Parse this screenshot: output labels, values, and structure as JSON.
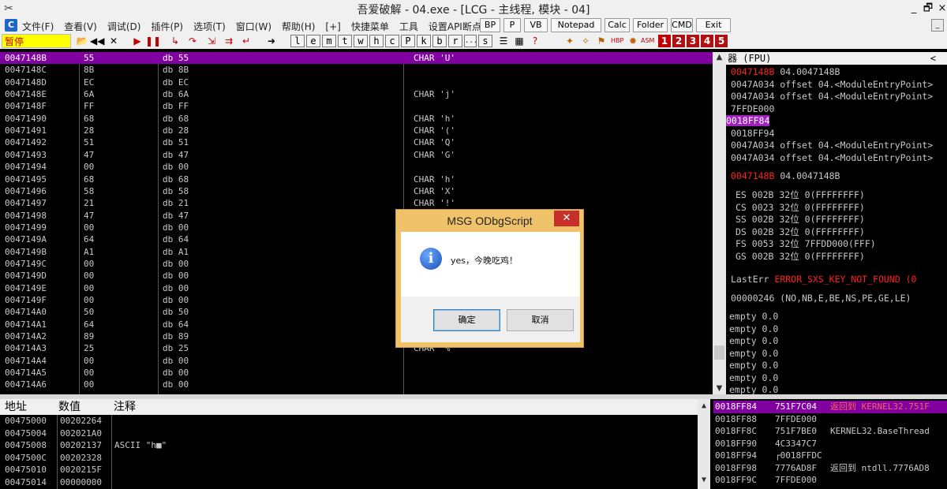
{
  "window": {
    "title": "吾爱破解 - 04.exe - [LCG - 主线程, 模块 - 04]",
    "restore_glyph": "🗗",
    "close_glyph": "×"
  },
  "menu": {
    "items": [
      "文件(F)",
      "查看(V)",
      "调试(D)",
      "插件(P)",
      "选项(T)",
      "窗口(W)",
      "帮助(H)",
      "[+]",
      "快捷菜单",
      "工具",
      "设置API断点>"
    ],
    "buttons": [
      "BP",
      "P",
      "VB",
      "Notepad",
      "Calc",
      "Folder",
      "CMD",
      "Exit"
    ],
    "mdi_minimize": "_"
  },
  "toolbar": {
    "status": "暂停",
    "letters": [
      "l",
      "e",
      "m",
      "t",
      "w",
      "h",
      "c",
      "P",
      "k",
      "b",
      "r",
      "...",
      "s"
    ],
    "numbers": [
      "1",
      "2",
      "3",
      "4",
      "5"
    ]
  },
  "disasm": {
    "rows": [
      {
        "addr": "0047148B",
        "hex": "55",
        "asm": "db 55",
        "cmt": "CHAR 'U'",
        "selected": true
      },
      {
        "addr": "0047148C",
        "hex": "8B",
        "asm": "db 8B",
        "cmt": ""
      },
      {
        "addr": "0047148D",
        "hex": "EC",
        "asm": "db EC",
        "cmt": ""
      },
      {
        "addr": "0047148E",
        "hex": "6A",
        "asm": "db 6A",
        "cmt": "CHAR 'j'"
      },
      {
        "addr": "0047148F",
        "hex": "FF",
        "asm": "db FF",
        "cmt": ""
      },
      {
        "addr": "00471490",
        "hex": "68",
        "asm": "db 68",
        "cmt": "CHAR 'h'"
      },
      {
        "addr": "00471491",
        "hex": "28",
        "asm": "db 28",
        "cmt": "CHAR '('"
      },
      {
        "addr": "00471492",
        "hex": "51",
        "asm": "db 51",
        "cmt": "CHAR 'Q'"
      },
      {
        "addr": "00471493",
        "hex": "47",
        "asm": "db 47",
        "cmt": "CHAR 'G'"
      },
      {
        "addr": "00471494",
        "hex": "00",
        "asm": "db 00",
        "cmt": ""
      },
      {
        "addr": "00471495",
        "hex": "68",
        "asm": "db 68",
        "cmt": "CHAR 'h'"
      },
      {
        "addr": "00471496",
        "hex": "58",
        "asm": "db 58",
        "cmt": "CHAR 'X'"
      },
      {
        "addr": "00471497",
        "hex": "21",
        "asm": "db 21",
        "cmt": "CHAR '!'"
      },
      {
        "addr": "00471498",
        "hex": "47",
        "asm": "db 47",
        "cmt": ""
      },
      {
        "addr": "00471499",
        "hex": "00",
        "asm": "db 00",
        "cmt": ""
      },
      {
        "addr": "0047149A",
        "hex": "64",
        "asm": "db 64",
        "cmt": ""
      },
      {
        "addr": "0047149B",
        "hex": "A1",
        "asm": "db A1",
        "cmt": ""
      },
      {
        "addr": "0047149C",
        "hex": "00",
        "asm": "db 00",
        "cmt": ""
      },
      {
        "addr": "0047149D",
        "hex": "00",
        "asm": "db 00",
        "cmt": ""
      },
      {
        "addr": "0047149E",
        "hex": "00",
        "asm": "db 00",
        "cmt": ""
      },
      {
        "addr": "0047149F",
        "hex": "00",
        "asm": "db 00",
        "cmt": ""
      },
      {
        "addr": "004714A0",
        "hex": "50",
        "asm": "db 50",
        "cmt": ""
      },
      {
        "addr": "004714A1",
        "hex": "64",
        "asm": "db 64",
        "cmt": ""
      },
      {
        "addr": "004714A2",
        "hex": "89",
        "asm": "db 89",
        "cmt": ""
      },
      {
        "addr": "004714A3",
        "hex": "25",
        "asm": "db 25",
        "cmt": "CHAR '%'"
      },
      {
        "addr": "004714A4",
        "hex": "00",
        "asm": "db 00",
        "cmt": ""
      },
      {
        "addr": "004714A5",
        "hex": "00",
        "asm": "db 00",
        "cmt": ""
      },
      {
        "addr": "004714A6",
        "hex": "00",
        "asm": "db 00",
        "cmt": ""
      }
    ]
  },
  "registers": {
    "header": "器 (FPU)",
    "collapse_glyph": "<",
    "stack_lines": [
      {
        "text": "0047148B 04.0047148B",
        "style": "red-addr"
      },
      {
        "text": "0047A034 offset 04.<ModuleEntryPoint>",
        "style": ""
      },
      {
        "text": "0047A034 offset 04.<ModuleEntryPoint>",
        "style": ""
      },
      {
        "text": "7FFDE000",
        "style": ""
      },
      {
        "text": "0018FF84",
        "style": "purple"
      },
      {
        "text": "0018FF94",
        "style": ""
      },
      {
        "text": "0047A034 offset 04.<ModuleEntryPoint>",
        "style": ""
      },
      {
        "text": "0047A034 offset 04.<ModuleEntryPoint>",
        "style": ""
      }
    ],
    "eip_line": "0047148B 04.0047148B",
    "segments": [
      "ES 002B 32位 0(FFFFFFFF)",
      "CS 0023 32位 0(FFFFFFFF)",
      "SS 002B 32位 0(FFFFFFFF)",
      "DS 002B 32位 0(FFFFFFFF)",
      "FS 0053 32位 7FFDD000(FFF)",
      "GS 002B 32位 0(FFFFFFFF)"
    ],
    "lasterr_label": "LastErr",
    "lasterr_value": "ERROR_SXS_KEY_NOT_FOUND (0",
    "eflags": "00000246 (NO,NB,E,BE,NS,PE,GE,LE)",
    "fpu": [
      "empty 0.0",
      "empty 0.0",
      "empty 0.0",
      "empty 0.0",
      "empty 0.0",
      "empty 0.0",
      "empty 0.0"
    ]
  },
  "dump": {
    "headers": {
      "addr": "地址",
      "value": "数值",
      "comment": "注释"
    },
    "rows": [
      {
        "addr": "00475000",
        "value": "00202264",
        "comment": ""
      },
      {
        "addr": "00475004",
        "value": "002021A0",
        "comment": ""
      },
      {
        "addr": "00475008",
        "value": "00202137",
        "comment": "ASCII \"h■\""
      },
      {
        "addr": "0047500C",
        "value": "00202328",
        "comment": ""
      },
      {
        "addr": "00475010",
        "value": "0020215F",
        "comment": ""
      },
      {
        "addr": "00475014",
        "value": "00000000",
        "comment": ""
      }
    ]
  },
  "stack": {
    "rows": [
      {
        "addr": "0018FF84",
        "value": "751F7C04",
        "comment": "返回到 KERNEL32.751F",
        "selected": true
      },
      {
        "addr": "0018FF88",
        "value": "7FFDE000",
        "comment": ""
      },
      {
        "addr": "0018FF8C",
        "value": "751F7BE0",
        "comment": "KERNEL32.BaseThread"
      },
      {
        "addr": "0018FF90",
        "value": "4C3347C7",
        "comment": ""
      },
      {
        "addr": "0018FF94",
        "value": "┌0018FFDC",
        "comment": ""
      },
      {
        "addr": "0018FF98",
        "value": "7776AD8F",
        "comment": "返回到 ntdll.7776AD8"
      },
      {
        "addr": "0018FF9C",
        "value": "7FFDE000",
        "comment": ""
      }
    ]
  },
  "dialog": {
    "title": "MSG ODbgScript",
    "close_glyph": "✕",
    "icon_glyph": "i",
    "message": "yes，今晚吃鸡！",
    "ok_label": "确定",
    "cancel_label": "取消"
  },
  "colors": {
    "selection": "#8000a0",
    "status_bg": "#ffff00",
    "status_text": "#d00000",
    "dialog_frame": "#f0c36a",
    "close_red": "#c7302a"
  }
}
